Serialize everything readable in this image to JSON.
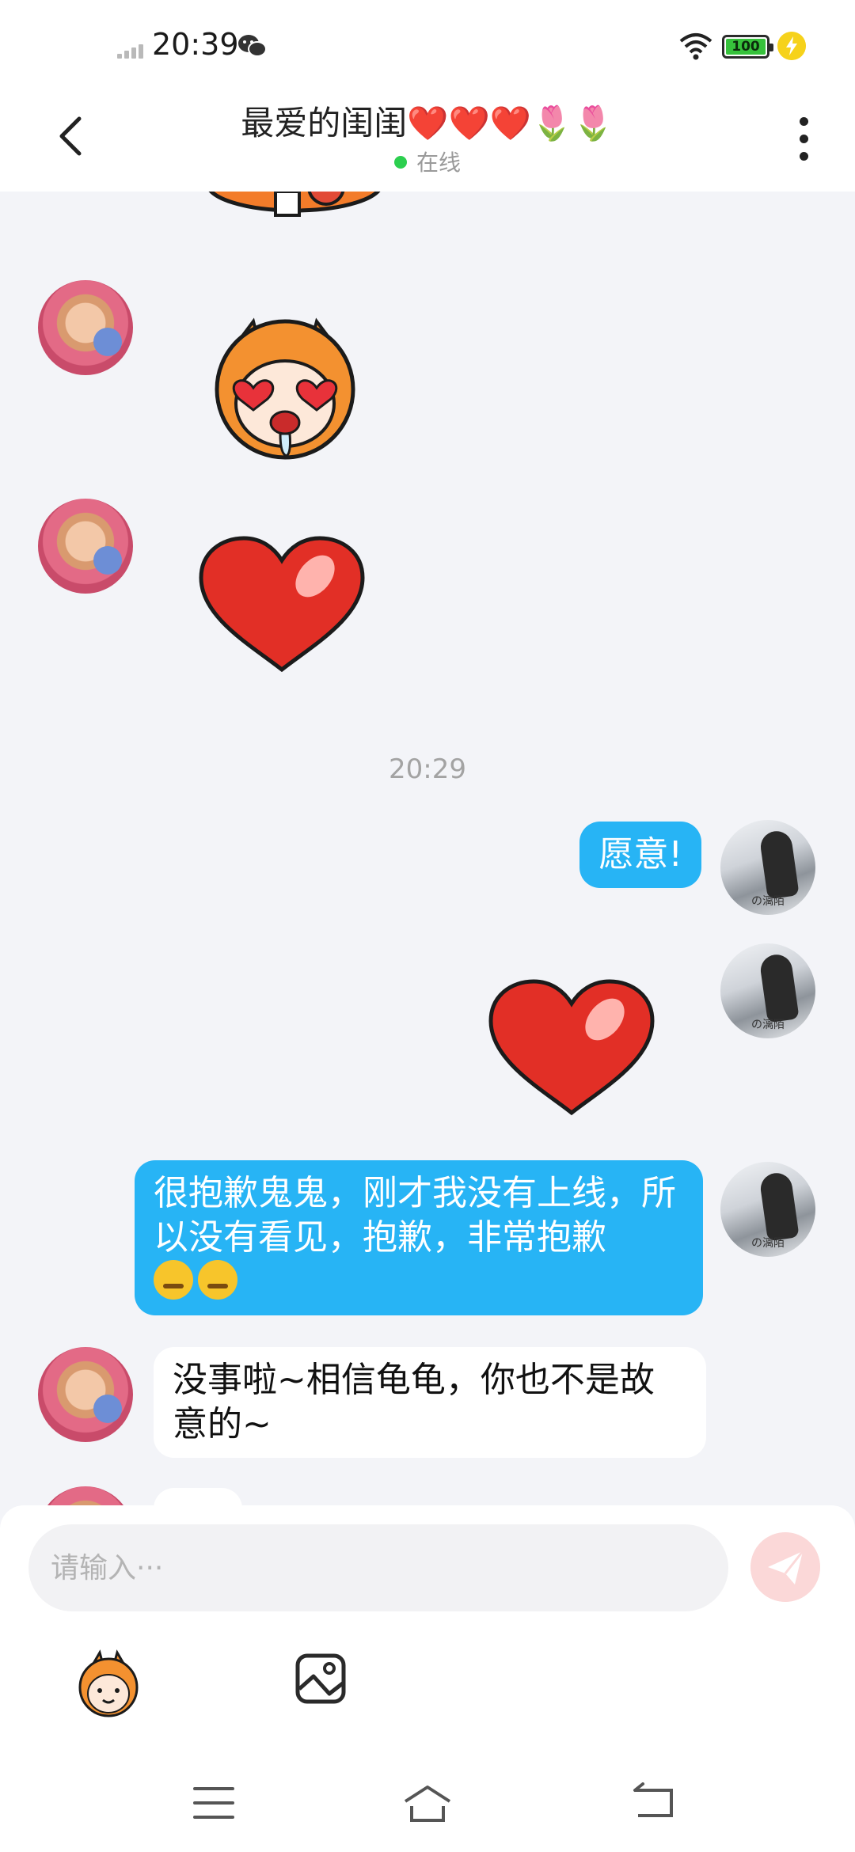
{
  "status_bar": {
    "time": "20:39",
    "battery_level": "100",
    "icons": [
      "signal-icon",
      "wechat-icon",
      "wifi-icon",
      "battery-icon",
      "charging-icon"
    ]
  },
  "header": {
    "title": "最爱的闺闺❤️❤️❤️🌷🌷",
    "presence": "在线",
    "icons": [
      "back-arrow-icon",
      "more-dots-icon"
    ]
  },
  "messages": {
    "timestamp": "20:29",
    "items": [
      {
        "sender": "friend",
        "type": "sticker",
        "content": "cartoon-sticker-partial"
      },
      {
        "sender": "friend",
        "type": "sticker",
        "content": "heart-eyes-sticker"
      },
      {
        "sender": "friend",
        "type": "sticker",
        "content": "red-heart-sticker"
      },
      {
        "sender": "self",
        "type": "text",
        "text": "愿意!"
      },
      {
        "sender": "self",
        "type": "sticker",
        "content": "red-heart-sticker"
      },
      {
        "sender": "self",
        "type": "text",
        "text": "很抱歉鬼鬼，刚才我没有上线，所以没有看见，抱歉，非常抱歉",
        "emoji": [
          "😖",
          "😔"
        ]
      },
      {
        "sender": "friend",
        "type": "text",
        "text": "没事啦~相信龟龟，你也不是故意的~"
      }
    ],
    "self_avatar_tag": "の漓陌"
  },
  "input": {
    "placeholder": "请输入···",
    "tools": [
      "sticker-tool-icon",
      "image-tool-icon"
    ]
  },
  "colors": {
    "self_bubble": "#27b4f5",
    "friend_bubble": "#ffffff",
    "background": "#f3f4f8",
    "online_dot": "#2ccf4f"
  }
}
